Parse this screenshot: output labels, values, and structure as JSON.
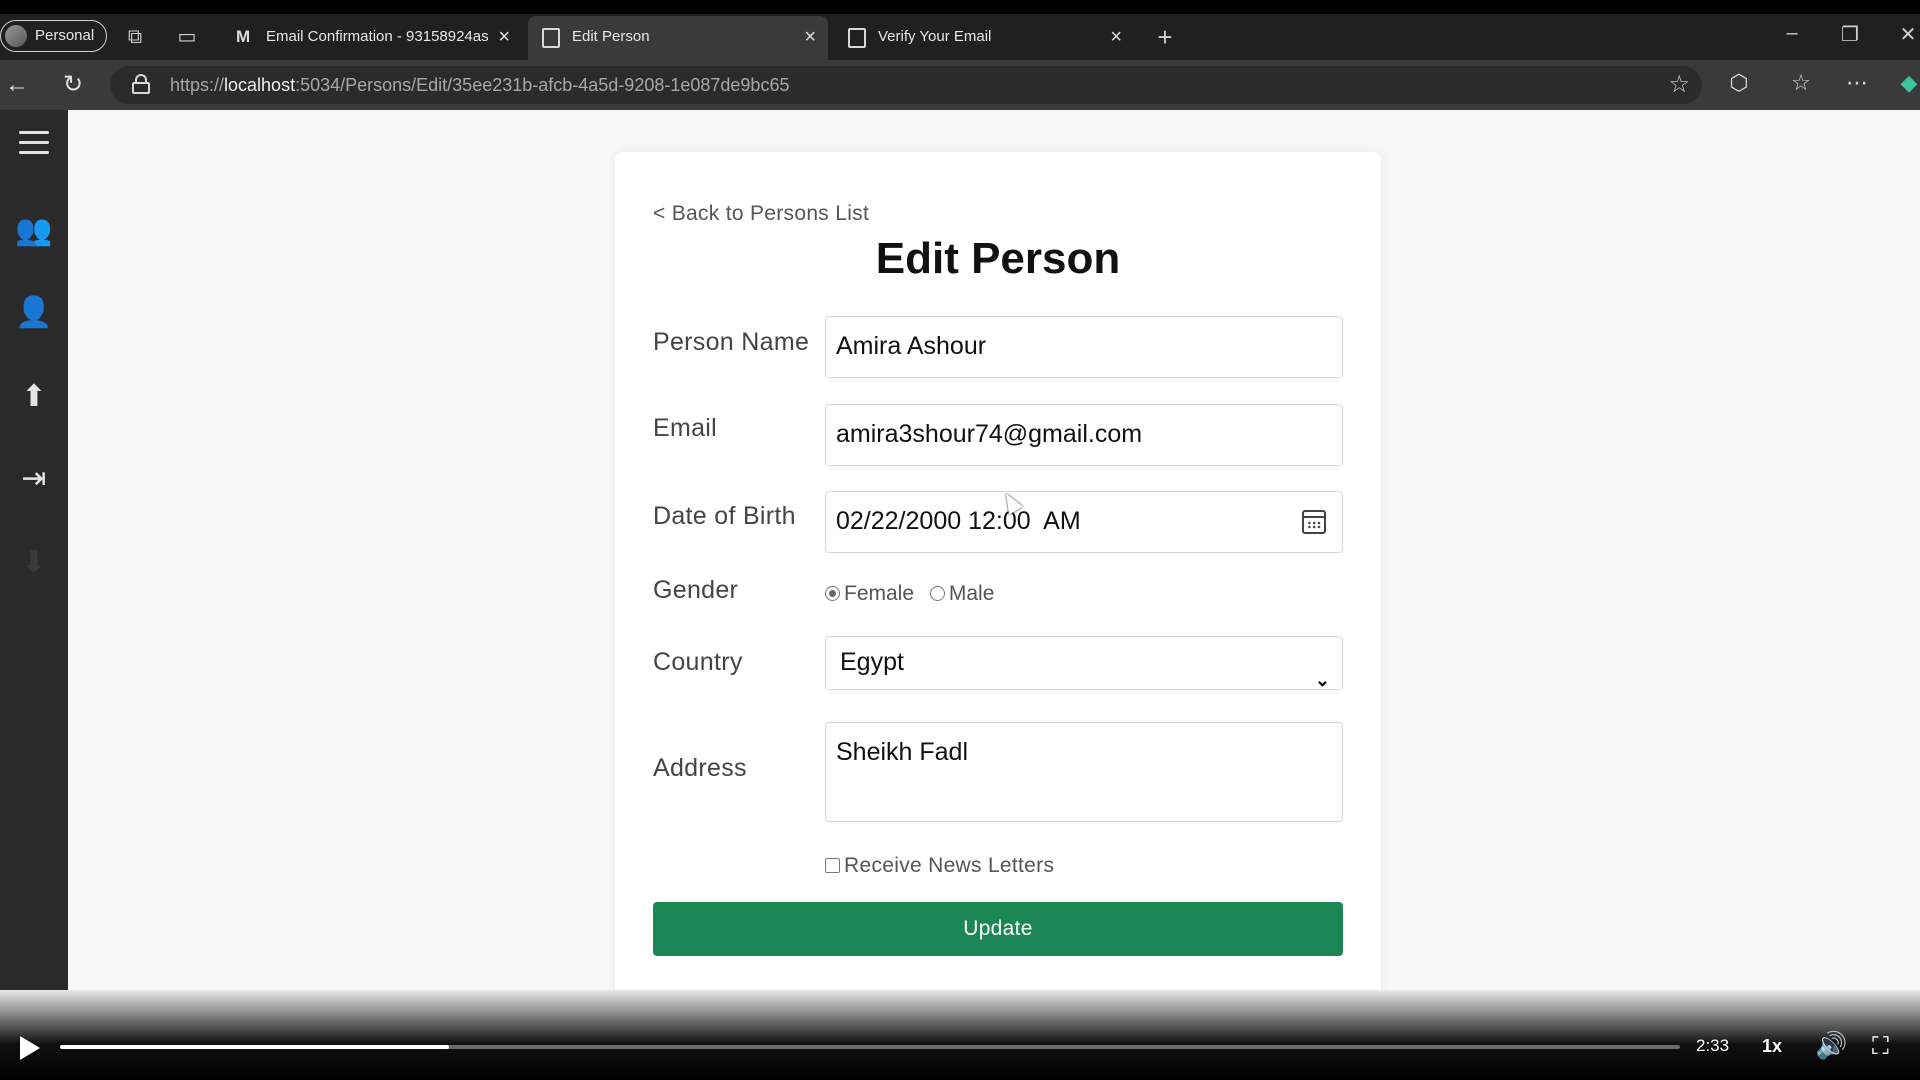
{
  "browser": {
    "profile_label": "Personal",
    "tabs": [
      {
        "title": "Email Confirmation - 93158924as",
        "icon": "gmail-icon"
      },
      {
        "title": "Edit Person",
        "icon": "page-icon",
        "active": true
      },
      {
        "title": "Verify Your Email",
        "icon": "page-icon"
      }
    ],
    "url_scheme": "https://",
    "url_host": "localhost",
    "url_rest": ":5034/Persons/Edit/35ee231b-afcb-4a5d-9208-1e087de9bc65"
  },
  "sidebar": {
    "items": [
      "menu-icon",
      "users-icon",
      "add-user-icon",
      "upload-file-icon",
      "logout-icon",
      "download-icon"
    ]
  },
  "form": {
    "back_link": "< Back to Persons List",
    "title": "Edit Person",
    "person_name_label": "Person Name",
    "person_name_value": "Amira Ashour",
    "email_label": "Email",
    "email_value": "amira3shour74@gmail.com",
    "dob_label": "Date of Birth",
    "dob_value": "02/22/2000 12:00  AM",
    "gender_label": "Gender",
    "gender_options": [
      "Female",
      "Male"
    ],
    "gender_selected": "Female",
    "country_label": "Country",
    "country_value": "Egypt",
    "address_label": "Address",
    "address_value": "Sheikh Fadl",
    "newsletter_label": "Receive News Letters",
    "newsletter_checked": false,
    "submit_label": "Update"
  },
  "player": {
    "time": "2:33",
    "speed": "1x",
    "progress_fraction": 0.24
  },
  "colors": {
    "update_button": "#1d8655",
    "sidebar_bg": "#2a2a2a"
  }
}
